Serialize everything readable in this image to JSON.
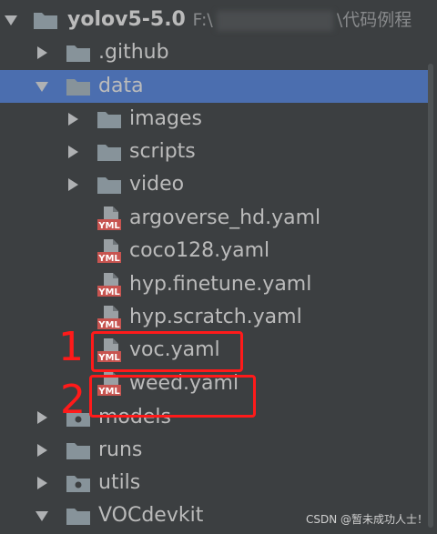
{
  "project": {
    "name": "yolov5-5.0",
    "path_prefix": "F:\\",
    "path_suffix": "\\代码例程"
  },
  "items": {
    "github": ".github",
    "data": "data",
    "images": "images",
    "scripts": "scripts",
    "video": "video",
    "argoverse": "argoverse_hd.yaml",
    "coco128": "coco128.yaml",
    "finetune": "hyp.finetune.yaml",
    "scratch": "hyp.scratch.yaml",
    "voc": "voc.yaml",
    "weed": "weed.yaml",
    "models": "models",
    "runs": "runs",
    "utils": "utils",
    "vocdevkit": "VOCdevkit"
  },
  "yml_icon_text": "YML",
  "annotations": {
    "one": "1",
    "two": "2",
    "color": "#ff1a1a"
  },
  "watermark": "CSDN @暂未成功人士！",
  "colors": {
    "background": "#3c3f41",
    "selection": "#4b6eaf",
    "text": "#bbbbbb",
    "folder": "#87939a",
    "yaml_icon": "#c75450"
  }
}
